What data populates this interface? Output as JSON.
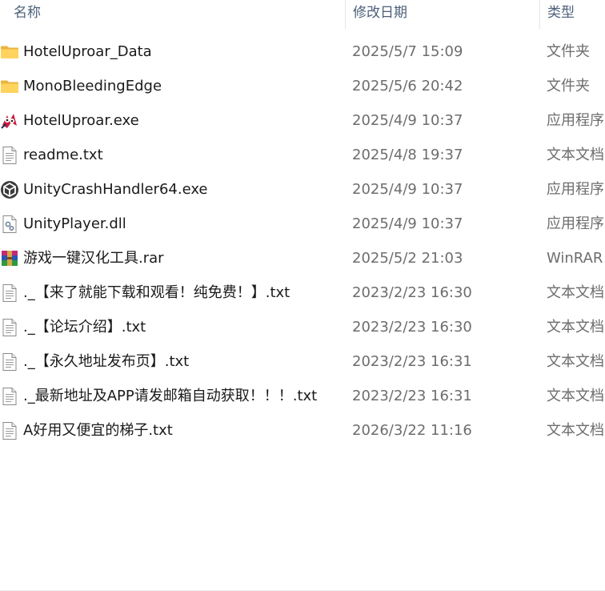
{
  "columns": {
    "name": "名称",
    "date": "修改日期",
    "type": "类型"
  },
  "sort_indicator": "^",
  "files": [
    {
      "name": "HotelUproar_Data",
      "date": "2025/5/7 15:09",
      "type": "文件夹",
      "icon": "folder-icon"
    },
    {
      "name": "MonoBleedingEdge",
      "date": "2025/5/6 20:42",
      "type": "文件夹",
      "icon": "folder-icon"
    },
    {
      "name": "HotelUproar.exe",
      "date": "2025/4/9 10:37",
      "type": "应用程序",
      "icon": "app-icon"
    },
    {
      "name": "readme.txt",
      "date": "2025/4/8 19:37",
      "type": "文本文档",
      "icon": "text-file-icon"
    },
    {
      "name": "UnityCrashHandler64.exe",
      "date": "2025/4/9 10:37",
      "type": "应用程序",
      "icon": "unity-icon"
    },
    {
      "name": "UnityPlayer.dll",
      "date": "2025/4/9 10:37",
      "type": "应用程序",
      "icon": "dll-file-icon"
    },
    {
      "name": "游戏一键汉化工具.rar",
      "date": "2025/5/2 21:03",
      "type": "WinRAR",
      "icon": "winrar-icon"
    },
    {
      "name": "._【来了就能下载和观看！纯免费！】.txt",
      "date": "2023/2/23 16:30",
      "type": "文本文档",
      "icon": "text-file-icon"
    },
    {
      "name": "._【论坛介绍】.txt",
      "date": "2023/2/23 16:30",
      "type": "文本文档",
      "icon": "text-file-icon"
    },
    {
      "name": "._【永久地址发布页】.txt",
      "date": "2023/2/23 16:31",
      "type": "文本文档",
      "icon": "text-file-icon"
    },
    {
      "name": "._最新地址及APP请发邮箱自动获取！！！.txt",
      "date": "2023/2/23 16:31",
      "type": "文本文档",
      "icon": "text-file-icon"
    },
    {
      "name": "A好用又便宜的梯子.txt",
      "date": "2026/3/22 11:16",
      "type": "文本文档",
      "icon": "text-file-icon"
    }
  ]
}
